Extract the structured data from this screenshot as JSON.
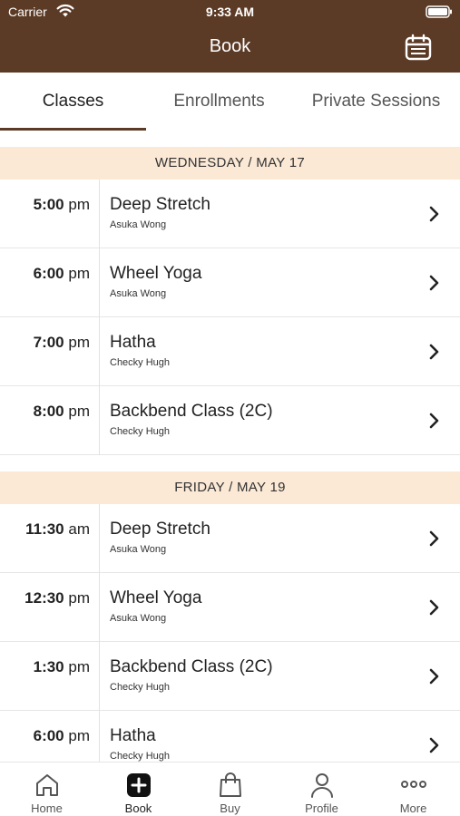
{
  "status": {
    "carrier": "Carrier",
    "time": "9:33 AM"
  },
  "header": {
    "title": "Book",
    "calendar_icon": "calendar-icon"
  },
  "tabs": [
    {
      "label": "Classes",
      "active": true
    },
    {
      "label": "Enrollments",
      "active": false
    },
    {
      "label": "Private Sessions",
      "active": false
    }
  ],
  "days": [
    {
      "header": "WEDNESDAY / MAY 17",
      "classes": [
        {
          "time": "5:00",
          "ampm": "pm",
          "name": "Deep Stretch",
          "instructor": "Asuka Wong"
        },
        {
          "time": "6:00",
          "ampm": "pm",
          "name": "Wheel Yoga",
          "instructor": "Asuka Wong"
        },
        {
          "time": "7:00",
          "ampm": "pm",
          "name": "Hatha",
          "instructor": "Checky Hugh"
        },
        {
          "time": "8:00",
          "ampm": "pm",
          "name": "Backbend Class (2C)",
          "instructor": "Checky Hugh"
        }
      ]
    },
    {
      "header": "FRIDAY / MAY 19",
      "classes": [
        {
          "time": "11:30",
          "ampm": "am",
          "name": "Deep Stretch",
          "instructor": "Asuka Wong"
        },
        {
          "time": "12:30",
          "ampm": "pm",
          "name": "Wheel Yoga",
          "instructor": "Asuka Wong"
        },
        {
          "time": "1:30",
          "ampm": "pm",
          "name": "Backbend Class (2C)",
          "instructor": "Checky Hugh"
        },
        {
          "time": "6:00",
          "ampm": "pm",
          "name": "Hatha",
          "instructor": "Checky Hugh"
        }
      ]
    }
  ],
  "bottom_nav": [
    {
      "label": "Home",
      "icon": "home-icon",
      "active": false
    },
    {
      "label": "Book",
      "icon": "plus-square-icon",
      "active": true
    },
    {
      "label": "Buy",
      "icon": "shopping-bag-icon",
      "active": false
    },
    {
      "label": "Profile",
      "icon": "person-icon",
      "active": false
    },
    {
      "label": "More",
      "icon": "more-dots-icon",
      "active": false
    }
  ],
  "colors": {
    "brand": "#5c3b26",
    "date_header_bg": "#fbe9d6"
  }
}
